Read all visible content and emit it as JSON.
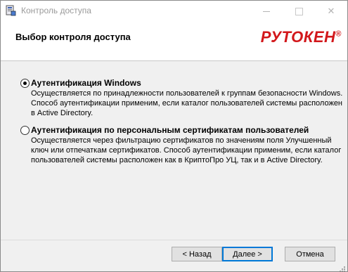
{
  "window": {
    "title": "Контроль доступа",
    "icons": {
      "app": "installer-icon",
      "minimize": "minimize-icon",
      "maximize": "maximize-icon",
      "close": "close-icon"
    },
    "close_glyph": "✕"
  },
  "header": {
    "title": "Выбор контроля доступа",
    "logo_text": "РУТОКЕН",
    "logo_reg": "®",
    "logo_color": "#d2171b"
  },
  "options": [
    {
      "label": "Аутентификация Windows",
      "description": "Осуществляется по принадлежности пользователей к группам безопасности Windows. Способ аутентификации применим, если каталог пользователей системы расположен в Active Directory.",
      "selected": true
    },
    {
      "label": "Аутентификация по персональным сертификатам пользователей",
      "description": "Осуществляется через фильтрацию сертификатов по значениям поля Улучшенный ключ или отпечаткам сертификатов. Способ аутентификации применим, если каталог пользователей системы расположен как в КриптоПро УЦ, так и в Active Directory.",
      "selected": false
    }
  ],
  "buttons": {
    "back": "< Назад",
    "next": "Далее >",
    "cancel": "Отмена"
  },
  "colors": {
    "accent": "#0078d7",
    "content_bg": "#f0f0f0"
  }
}
